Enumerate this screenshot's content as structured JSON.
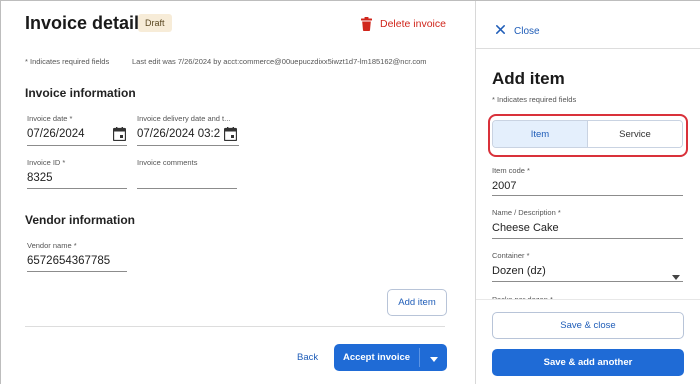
{
  "invoice": {
    "title": "Invoice details",
    "status_badge": "Draft",
    "delete_label": "Delete invoice",
    "required_note": "* Indicates required fields",
    "last_edit": "Last edit was 7/26/2024 by acct:commerce@00uepuczdixx5iwzt1d7-lm185162@ncr.com",
    "info_section": "Invoice information",
    "invoice_date_label": "Invoice date *",
    "invoice_date_value": "07/26/2024",
    "delivery_date_label": "Invoice delivery date and t...",
    "delivery_date_value": "07/26/2024 03:2",
    "invoice_id_label": "Invoice ID *",
    "invoice_id_value": "8325",
    "comments_label": "Invoice comments",
    "comments_value": "",
    "vendor_section": "Vendor information",
    "vendor_name_label": "Vendor name *",
    "vendor_name_value": "6572654367785",
    "add_item_label": "Add item",
    "back_label": "Back",
    "accept_label": "Accept invoice"
  },
  "panel": {
    "close_label": "Close",
    "title": "Add item",
    "required_note": "* Indicates required fields",
    "tabs": [
      {
        "label": "Item",
        "selected": true
      },
      {
        "label": "Service",
        "selected": false
      }
    ],
    "item_code_label": "Item code *",
    "item_code_value": "2007",
    "name_label": "Name / Description *",
    "name_value": "Cheese Cake",
    "container_label": "Container *",
    "container_value": "Dozen (dz)",
    "packs_label": "Packs per dozen *",
    "save_close_label": "Save & close",
    "save_add_label": "Save & add another"
  },
  "colors": {
    "accent": "#1f6bd6",
    "danger": "#d0261c",
    "highlight": "#d9313a",
    "badge_bg": "#f7ecd8"
  },
  "icons": [
    "trash-icon",
    "calendar-icon",
    "close-icon",
    "chevron-down-icon",
    "dropdown-arrow-icon"
  ]
}
